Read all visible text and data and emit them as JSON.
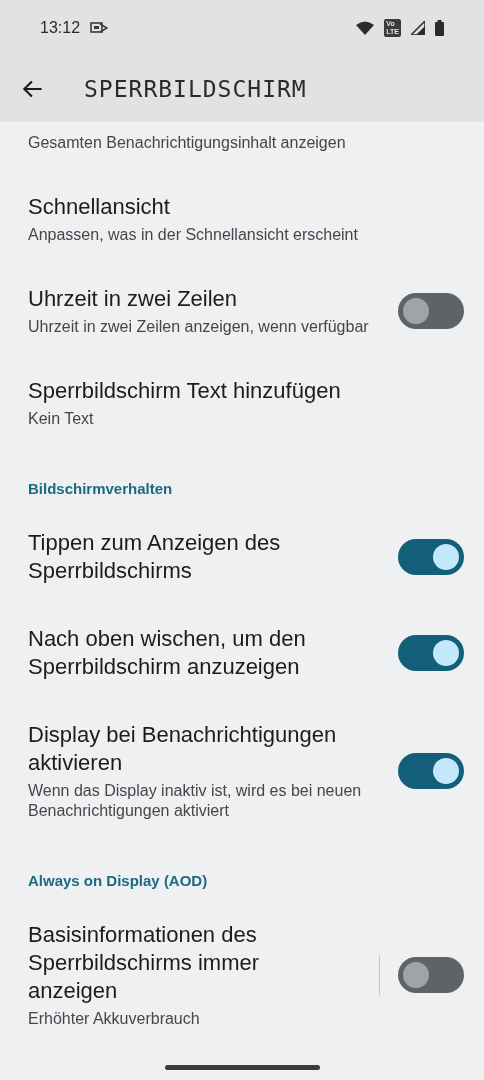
{
  "status_bar": {
    "time": "13:12",
    "volte": [
      "Vo",
      "LTE"
    ]
  },
  "app_bar": {
    "title": "SPERRBILDSCHIRM"
  },
  "items": [
    {
      "kind": "setting",
      "subtitle": "Gesamten Benachrichtigungsinhalt anzeigen"
    },
    {
      "kind": "setting",
      "title": "Schnellansicht",
      "subtitle": "Anpassen, was in der Schnellansicht erscheint"
    },
    {
      "kind": "switch",
      "title": "Uhrzeit in zwei Zeilen",
      "subtitle": "Uhrzeit in zwei Zeilen anzeigen, wenn verfügbar",
      "on": false
    },
    {
      "kind": "setting",
      "title": "Sperrbildschirm Text hinzufügen",
      "subtitle": "Kein Text"
    },
    {
      "kind": "header",
      "title": "Bildschirmverhalten"
    },
    {
      "kind": "switch",
      "title": "Tippen zum Anzeigen des Sperrbildschirms",
      "on": true
    },
    {
      "kind": "switch",
      "title": "Nach oben wischen, um den Sperrbildschirm anzuzeigen",
      "on": true
    },
    {
      "kind": "switch",
      "title": "Display bei Benachrichtigungen aktivieren",
      "subtitle": "Wenn das Display inaktiv ist, wird es bei neuen Benachrichtigungen aktiviert",
      "on": true
    },
    {
      "kind": "header",
      "title": "Always on Display (AOD)"
    },
    {
      "kind": "switch",
      "title": "Basisinformationen des Sperrbildschirms immer anzeigen",
      "subtitle": "Erhöhter Akkuverbrauch",
      "on": false,
      "divider": true
    }
  ]
}
